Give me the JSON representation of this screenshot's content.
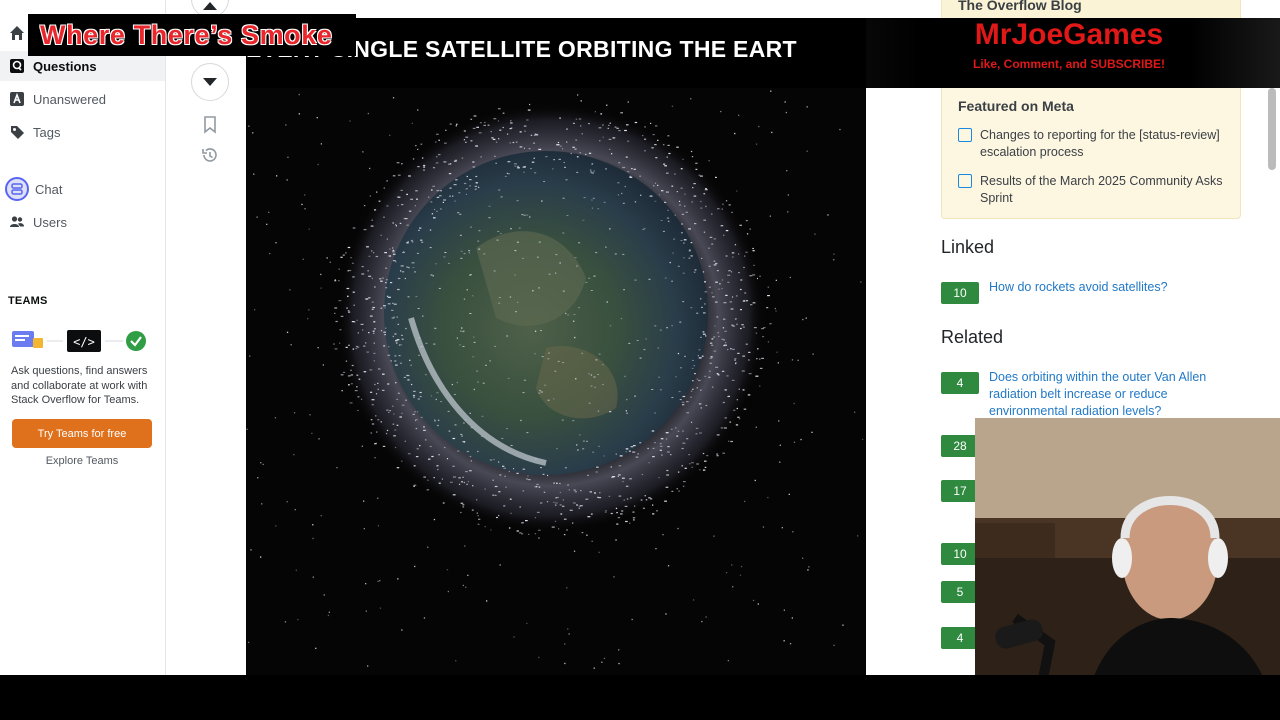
{
  "overlay": {
    "show_title": "Where There’s Smoke",
    "channel_name": "MrJoeGames",
    "channel_tagline": "Like, Comment, and SUBSCRIBE!"
  },
  "left_nav": {
    "items": [
      {
        "label": "Questions",
        "icon": "questions-icon",
        "active": true
      },
      {
        "label": "Unanswered",
        "icon": "unanswered-icon"
      },
      {
        "label": "Tags",
        "icon": "tag-icon"
      },
      {
        "label": "Chat",
        "icon": "chat-icon"
      },
      {
        "label": "Users",
        "icon": "users-icon"
      }
    ],
    "teams_heading": "TEAMS",
    "teams_description": "Ask questions, find answers and collaborate at work with Stack Overflow for Teams.",
    "teams_button": "Try Teams for free",
    "teams_explore": "Explore Teams"
  },
  "video": {
    "caption_visible": "SINGLE SATELLITE ORBITING THE EART",
    "caption_partial": "EVERY"
  },
  "sidebar": {
    "blog_title": "The Overflow Blog",
    "featured_meta_title": "Featured on Meta",
    "featured_meta_items": [
      "Changes to reporting for the [status-review] escalation process",
      "Results of the March 2025 Community Asks Sprint"
    ],
    "linked_heading": "Linked",
    "linked": [
      {
        "score": "10",
        "title": "How do rockets avoid satellites?"
      }
    ],
    "related_heading": "Related",
    "related": [
      {
        "score": "4",
        "title": "Does orbiting within the outer Van Allen radiation belt increase or reduce environmental radiation levels?"
      },
      {
        "score": "28",
        "title": ""
      },
      {
        "score": "17",
        "title": ""
      },
      {
        "score": "10",
        "title": ""
      },
      {
        "score": "5",
        "title": ""
      },
      {
        "score": "4",
        "title": ""
      }
    ]
  },
  "colors": {
    "accent_orange": "#e0711c",
    "score_green": "#2f8a3f",
    "link_blue": "#2279c6",
    "brand_red": "#e01818"
  }
}
